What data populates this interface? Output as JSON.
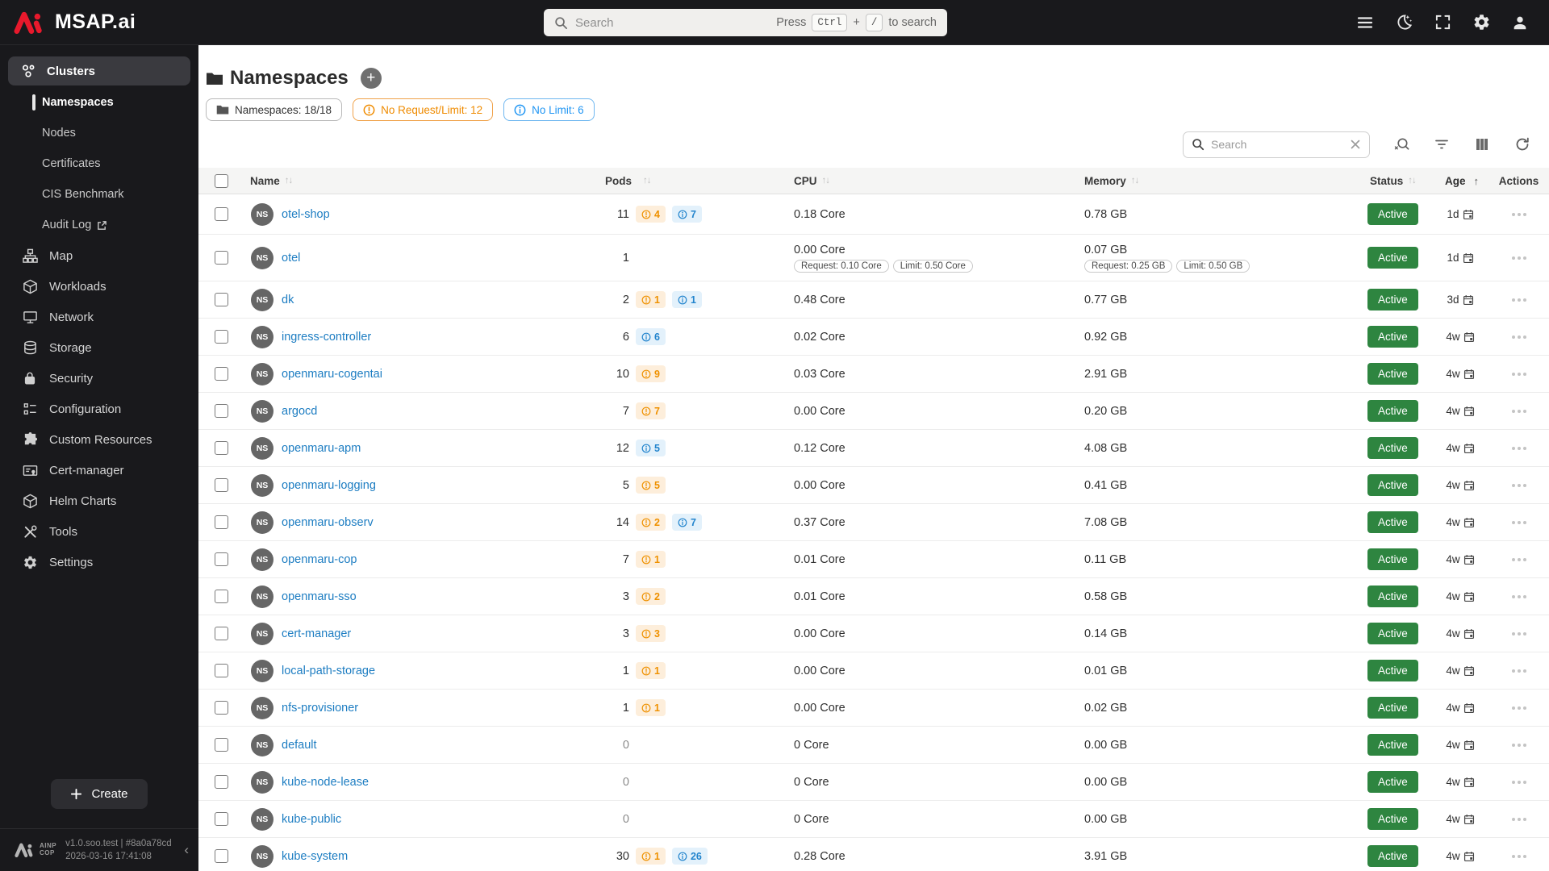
{
  "brand": {
    "logo_text": "MSAP.ai",
    "footer_brand_line1": "AINP",
    "footer_brand_line2": "COP"
  },
  "topbar": {
    "search_placeholder": "Search",
    "hint_press": "Press",
    "hint_ctrl": "Ctrl",
    "hint_plus": "+",
    "hint_slash": "/",
    "hint_suffix": "to search"
  },
  "sidebar": {
    "top_item": {
      "label": "Clusters"
    },
    "sub_items": [
      {
        "label": "Namespaces"
      },
      {
        "label": "Nodes"
      },
      {
        "label": "Certificates"
      },
      {
        "label": "CIS Benchmark"
      },
      {
        "label": "Audit Log"
      }
    ],
    "items": [
      {
        "label": "Map"
      },
      {
        "label": "Workloads"
      },
      {
        "label": "Network"
      },
      {
        "label": "Storage"
      },
      {
        "label": "Security"
      },
      {
        "label": "Configuration"
      },
      {
        "label": "Custom Resources"
      },
      {
        "label": "Cert-manager"
      },
      {
        "label": "Helm Charts"
      },
      {
        "label": "Tools"
      },
      {
        "label": "Settings"
      }
    ],
    "create_label": "Create",
    "version_line1": "v1.0.soo.test | #8a0a78cd",
    "version_line2": "2026-03-16 17:41:08",
    "collapse_glyph": "‹"
  },
  "page": {
    "title": "Namespaces",
    "badges": [
      {
        "label": "Namespaces: 18/18",
        "type": "neutral"
      },
      {
        "label": "No Request/Limit: 12",
        "type": "warning"
      },
      {
        "label": "No Limit: 6",
        "type": "info"
      }
    ],
    "table_search_placeholder": "Search"
  },
  "table": {
    "ns_badge": "NS",
    "columns": {
      "name": "Name",
      "pods": "Pods",
      "cpu": "CPU",
      "memory": "Memory",
      "status": "Status",
      "age": "Age",
      "actions": "Actions"
    },
    "rows": [
      {
        "name": "otel-shop",
        "pods": "11",
        "warn": "4",
        "info": "7",
        "cpu": "0.18 Core",
        "memory": "0.78 GB",
        "status": "Active",
        "age": "1d"
      },
      {
        "name": "otel",
        "pods": "1",
        "cpu": "0.00 Core",
        "cpu_request": "Request: 0.10 Core",
        "cpu_limit": "Limit: 0.50 Core",
        "memory": "0.07 GB",
        "mem_request": "Request: 0.25 GB",
        "mem_limit": "Limit: 0.50 GB",
        "status": "Active",
        "age": "1d"
      },
      {
        "name": "dk",
        "pods": "2",
        "warn": "1",
        "info": "1",
        "cpu": "0.48 Core",
        "memory": "0.77 GB",
        "status": "Active",
        "age": "3d"
      },
      {
        "name": "ingress-controller",
        "pods": "6",
        "info": "6",
        "cpu": "0.02 Core",
        "memory": "0.92 GB",
        "status": "Active",
        "age": "4w"
      },
      {
        "name": "openmaru-cogentai",
        "pods": "10",
        "warn": "9",
        "cpu": "0.03 Core",
        "memory": "2.91 GB",
        "status": "Active",
        "age": "4w"
      },
      {
        "name": "argocd",
        "pods": "7",
        "warn": "7",
        "cpu": "0.00 Core",
        "memory": "0.20 GB",
        "status": "Active",
        "age": "4w"
      },
      {
        "name": "openmaru-apm",
        "pods": "12",
        "info": "5",
        "cpu": "0.12 Core",
        "memory": "4.08 GB",
        "status": "Active",
        "age": "4w"
      },
      {
        "name": "openmaru-logging",
        "pods": "5",
        "warn": "5",
        "cpu": "0.00 Core",
        "memory": "0.41 GB",
        "status": "Active",
        "age": "4w"
      },
      {
        "name": "openmaru-observ",
        "pods": "14",
        "warn": "2",
        "info": "7",
        "cpu": "0.37 Core",
        "memory": "7.08 GB",
        "status": "Active",
        "age": "4w"
      },
      {
        "name": "openmaru-cop",
        "pods": "7",
        "warn": "1",
        "cpu": "0.01 Core",
        "memory": "0.11 GB",
        "status": "Active",
        "age": "4w"
      },
      {
        "name": "openmaru-sso",
        "pods": "3",
        "warn": "2",
        "cpu": "0.01 Core",
        "memory": "0.58 GB",
        "status": "Active",
        "age": "4w"
      },
      {
        "name": "cert-manager",
        "pods": "3",
        "warn": "3",
        "cpu": "0.00 Core",
        "memory": "0.14 GB",
        "status": "Active",
        "age": "4w"
      },
      {
        "name": "local-path-storage",
        "pods": "1",
        "warn": "1",
        "cpu": "0.00 Core",
        "memory": "0.01 GB",
        "status": "Active",
        "age": "4w"
      },
      {
        "name": "nfs-provisioner",
        "pods": "1",
        "warn": "1",
        "cpu": "0.00 Core",
        "memory": "0.02 GB",
        "status": "Active",
        "age": "4w"
      },
      {
        "name": "default",
        "pods": "0",
        "cpu": "0 Core",
        "memory": "0.00 GB",
        "status": "Active",
        "age": "4w"
      },
      {
        "name": "kube-node-lease",
        "pods": "0",
        "cpu": "0 Core",
        "memory": "0.00 GB",
        "status": "Active",
        "age": "4w"
      },
      {
        "name": "kube-public",
        "pods": "0",
        "cpu": "0 Core",
        "memory": "0.00 GB",
        "status": "Active",
        "age": "4w"
      },
      {
        "name": "kube-system",
        "pods": "30",
        "warn": "1",
        "info": "26",
        "cpu": "0.28 Core",
        "memory": "3.91 GB",
        "status": "Active",
        "age": "4w"
      }
    ]
  },
  "colors": {
    "brand_red": "#e8192c",
    "link_blue": "#1d7dc2",
    "warn_orange": "#ef9100",
    "info_blue": "#2196f3",
    "active_green": "#2e8540",
    "sidebar_bg": "#19191c"
  }
}
